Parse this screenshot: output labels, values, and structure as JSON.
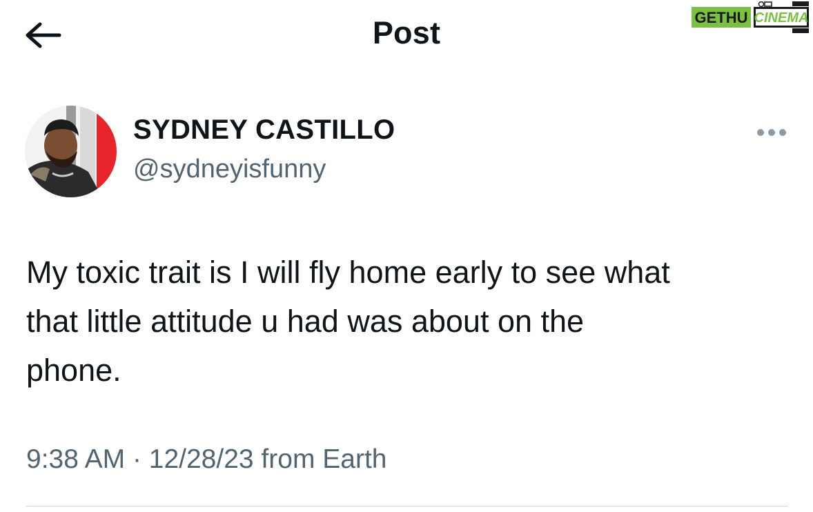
{
  "header": {
    "title": "Post",
    "back_icon": "arrow-left-icon"
  },
  "watermark": {
    "text_part1": "GETHU",
    "text_part2": "CINEMA",
    "color_green": "#7ac143",
    "color_dark": "#1a1a1a"
  },
  "author": {
    "display_name": "SYDNEY CASTILLO",
    "handle": "@sydneyisfunny",
    "avatar_icon": "avatar-photo"
  },
  "post": {
    "text": "My toxic trait is I will fly home early to see what\nthat little attitude u had was about on the\nphone."
  },
  "meta": {
    "time": "9:38 AM",
    "separator": "·",
    "date_and_source": "12/28/23 from Earth"
  },
  "more_icon": "more-dots-icon",
  "colors": {
    "text_primary": "#0f1419",
    "text_secondary": "#536471",
    "divider": "#cfd9de"
  }
}
